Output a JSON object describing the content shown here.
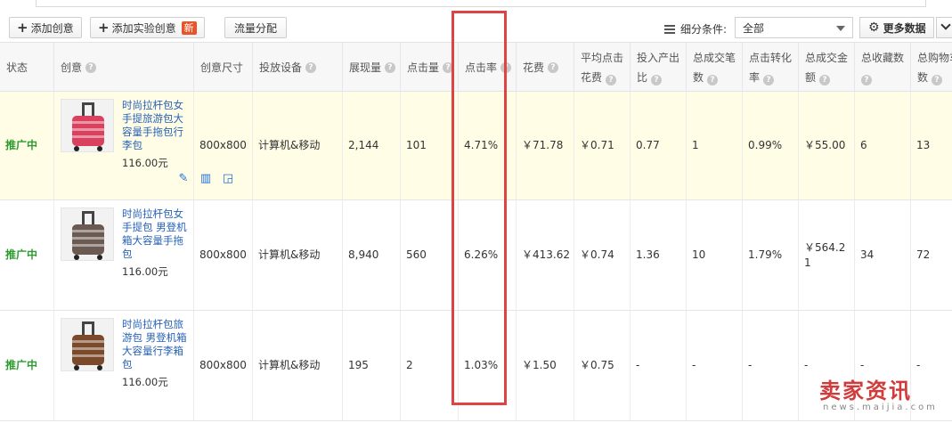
{
  "toolbar": {
    "add_creative": "添加创意",
    "add_experiment": "添加实验创意",
    "new_badge": "新",
    "traffic_split": "流量分配",
    "filter_label": "细分条件:",
    "filter_value": "全部",
    "more_data": "更多数据"
  },
  "headers": {
    "status": "状态",
    "creative": "创意",
    "size": "创意尺寸",
    "device": "投放设备",
    "impressions": "展现量",
    "clicks": "点击量",
    "ctr": "点击率",
    "cost": "花费",
    "avg_cpc_1": "平均点击",
    "avg_cpc_2": "花费",
    "roi_1": "投入产出",
    "roi_2": "比",
    "orders_1": "总成交笔",
    "orders_2": "数",
    "conv_1": "点击转化",
    "conv_2": "率",
    "gmv_1": "总成交金",
    "gmv_2": "额",
    "fav_1": "总收藏数",
    "cart_1": "总购物车",
    "cart_2": "数"
  },
  "rows": [
    {
      "status": "推广中",
      "title": "时尚拉杆包女手提旅游包大容量手拖包行李包",
      "price": "116.00元",
      "size": "800x800",
      "device": "计算机&移动",
      "impressions": "2,144",
      "clicks": "101",
      "ctr": "4.71%",
      "cost": "￥71.78",
      "avg_cpc": "￥0.71",
      "roi": "0.77",
      "orders": "1",
      "conv": "0.99%",
      "gmv": "￥55.00",
      "fav": "6",
      "cart": "13",
      "bag_color": "#d9415e"
    },
    {
      "status": "推广中",
      "title": "时尚拉杆包女手提包 男登机箱大容量手拖包",
      "price": "116.00元",
      "size": "800x800",
      "device": "计算机&移动",
      "impressions": "8,940",
      "clicks": "560",
      "ctr": "6.26%",
      "cost": "￥413.62",
      "avg_cpc": "￥0.74",
      "roi": "1.36",
      "orders": "10",
      "conv": "1.79%",
      "gmv": "￥564.21",
      "fav": "34",
      "cart": "72",
      "bag_color": "#6b5a52"
    },
    {
      "status": "推广中",
      "title": "时尚拉杆包旅游包 男登机箱 大容量行李箱包",
      "price": "116.00元",
      "size": "800x800",
      "device": "计算机&移动",
      "impressions": "195",
      "clicks": "2",
      "ctr": "1.03%",
      "cost": "￥1.50",
      "avg_cpc": "￥0.75",
      "roi": "-",
      "orders": "-",
      "conv": "-",
      "gmv": "-",
      "fav": "-",
      "cart": "-",
      "bag_color": "#7a4a2a"
    }
  ],
  "watermark": {
    "main": "卖家资讯",
    "sub": "news.maijia.com"
  }
}
